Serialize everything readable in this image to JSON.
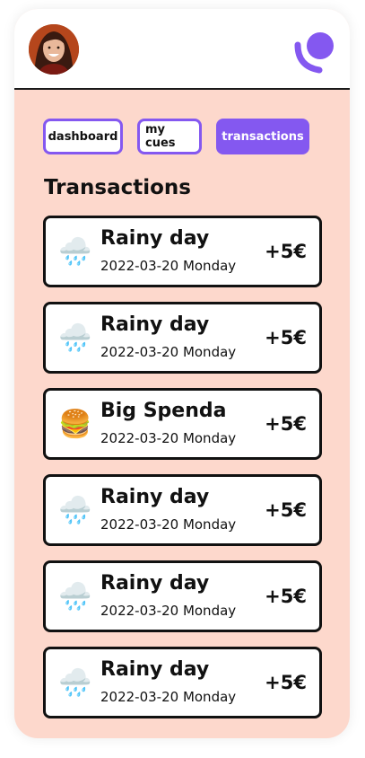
{
  "nav": {
    "avatar_icon": "user-photo",
    "logo_icon": "brand-logo",
    "tabs": [
      {
        "label": "dashboard",
        "active": false
      },
      {
        "label": "my cues",
        "active": false
      },
      {
        "label": "transactions",
        "active": true
      }
    ]
  },
  "main": {
    "title": "Transactions",
    "transactions": [
      {
        "icon": "🌧️",
        "icon_name": "rain-cloud-icon",
        "title": "Rainy day",
        "date": "2022-03-20 Monday",
        "amount": "+5€"
      },
      {
        "icon": "🌧️",
        "icon_name": "rain-cloud-icon",
        "title": "Rainy day",
        "date": "2022-03-20 Monday",
        "amount": "+5€"
      },
      {
        "icon": "🍔",
        "icon_name": "burger-icon",
        "title": "Big Spenda",
        "date": "2022-03-20 Monday",
        "amount": "+5€"
      },
      {
        "icon": "🌧️",
        "icon_name": "rain-cloud-icon",
        "title": "Rainy day",
        "date": "2022-03-20 Monday",
        "amount": "+5€"
      },
      {
        "icon": "🌧️",
        "icon_name": "rain-cloud-icon",
        "title": "Rainy day",
        "date": "2022-03-20 Monday",
        "amount": "+5€"
      },
      {
        "icon": "🌧️",
        "icon_name": "rain-cloud-icon",
        "title": "Rainy day",
        "date": "2022-03-20 Monday",
        "amount": "+5€"
      }
    ]
  },
  "colors": {
    "background": "#fdd8cc",
    "accent": "#8458f0",
    "border": "#111111"
  }
}
